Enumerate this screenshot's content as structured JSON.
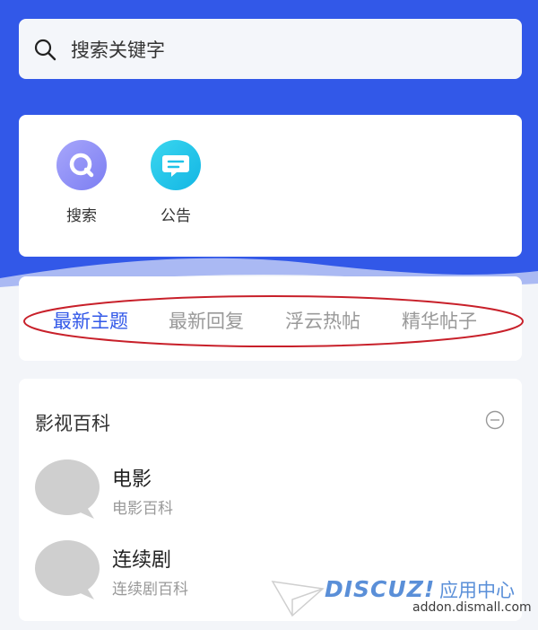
{
  "search": {
    "placeholder": "搜索关键字",
    "icon": "search-icon"
  },
  "quick_links": [
    {
      "label": "搜索",
      "icon": "search-circle-icon",
      "color": "#8a8cf7"
    },
    {
      "label": "公告",
      "icon": "announcement-chat-icon",
      "color": "#1fc3e8"
    }
  ],
  "tabs": [
    "最新主题",
    "最新回复",
    "浮云热帖",
    "精华帖子"
  ],
  "active_tab": "最新主题",
  "section": {
    "title": "影视百科",
    "forums": [
      {
        "name": "电影",
        "desc": "电影百科"
      },
      {
        "name": "连续剧",
        "desc": "连续剧百科"
      }
    ]
  },
  "watermark": {
    "brand": "DISCUZ!",
    "cn": "应用中心",
    "url": "addon.dismall.com"
  },
  "colors": {
    "accent": "#3258e8",
    "annotation": "#c8202a"
  }
}
